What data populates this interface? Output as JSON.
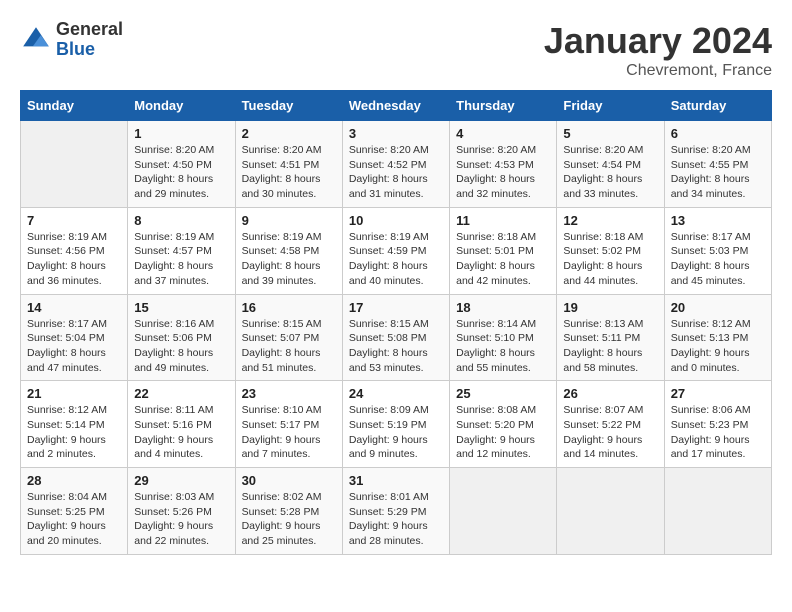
{
  "logo": {
    "general": "General",
    "blue": "Blue"
  },
  "header": {
    "month": "January 2024",
    "location": "Chevremont, France"
  },
  "weekdays": [
    "Sunday",
    "Monday",
    "Tuesday",
    "Wednesday",
    "Thursday",
    "Friday",
    "Saturday"
  ],
  "weeks": [
    [
      {
        "day": "",
        "info": ""
      },
      {
        "day": "1",
        "info": "Sunrise: 8:20 AM\nSunset: 4:50 PM\nDaylight: 8 hours\nand 29 minutes."
      },
      {
        "day": "2",
        "info": "Sunrise: 8:20 AM\nSunset: 4:51 PM\nDaylight: 8 hours\nand 30 minutes."
      },
      {
        "day": "3",
        "info": "Sunrise: 8:20 AM\nSunset: 4:52 PM\nDaylight: 8 hours\nand 31 minutes."
      },
      {
        "day": "4",
        "info": "Sunrise: 8:20 AM\nSunset: 4:53 PM\nDaylight: 8 hours\nand 32 minutes."
      },
      {
        "day": "5",
        "info": "Sunrise: 8:20 AM\nSunset: 4:54 PM\nDaylight: 8 hours\nand 33 minutes."
      },
      {
        "day": "6",
        "info": "Sunrise: 8:20 AM\nSunset: 4:55 PM\nDaylight: 8 hours\nand 34 minutes."
      }
    ],
    [
      {
        "day": "7",
        "info": "Sunrise: 8:19 AM\nSunset: 4:56 PM\nDaylight: 8 hours\nand 36 minutes."
      },
      {
        "day": "8",
        "info": "Sunrise: 8:19 AM\nSunset: 4:57 PM\nDaylight: 8 hours\nand 37 minutes."
      },
      {
        "day": "9",
        "info": "Sunrise: 8:19 AM\nSunset: 4:58 PM\nDaylight: 8 hours\nand 39 minutes."
      },
      {
        "day": "10",
        "info": "Sunrise: 8:19 AM\nSunset: 4:59 PM\nDaylight: 8 hours\nand 40 minutes."
      },
      {
        "day": "11",
        "info": "Sunrise: 8:18 AM\nSunset: 5:01 PM\nDaylight: 8 hours\nand 42 minutes."
      },
      {
        "day": "12",
        "info": "Sunrise: 8:18 AM\nSunset: 5:02 PM\nDaylight: 8 hours\nand 44 minutes."
      },
      {
        "day": "13",
        "info": "Sunrise: 8:17 AM\nSunset: 5:03 PM\nDaylight: 8 hours\nand 45 minutes."
      }
    ],
    [
      {
        "day": "14",
        "info": "Sunrise: 8:17 AM\nSunset: 5:04 PM\nDaylight: 8 hours\nand 47 minutes."
      },
      {
        "day": "15",
        "info": "Sunrise: 8:16 AM\nSunset: 5:06 PM\nDaylight: 8 hours\nand 49 minutes."
      },
      {
        "day": "16",
        "info": "Sunrise: 8:15 AM\nSunset: 5:07 PM\nDaylight: 8 hours\nand 51 minutes."
      },
      {
        "day": "17",
        "info": "Sunrise: 8:15 AM\nSunset: 5:08 PM\nDaylight: 8 hours\nand 53 minutes."
      },
      {
        "day": "18",
        "info": "Sunrise: 8:14 AM\nSunset: 5:10 PM\nDaylight: 8 hours\nand 55 minutes."
      },
      {
        "day": "19",
        "info": "Sunrise: 8:13 AM\nSunset: 5:11 PM\nDaylight: 8 hours\nand 58 minutes."
      },
      {
        "day": "20",
        "info": "Sunrise: 8:12 AM\nSunset: 5:13 PM\nDaylight: 9 hours\nand 0 minutes."
      }
    ],
    [
      {
        "day": "21",
        "info": "Sunrise: 8:12 AM\nSunset: 5:14 PM\nDaylight: 9 hours\nand 2 minutes."
      },
      {
        "day": "22",
        "info": "Sunrise: 8:11 AM\nSunset: 5:16 PM\nDaylight: 9 hours\nand 4 minutes."
      },
      {
        "day": "23",
        "info": "Sunrise: 8:10 AM\nSunset: 5:17 PM\nDaylight: 9 hours\nand 7 minutes."
      },
      {
        "day": "24",
        "info": "Sunrise: 8:09 AM\nSunset: 5:19 PM\nDaylight: 9 hours\nand 9 minutes."
      },
      {
        "day": "25",
        "info": "Sunrise: 8:08 AM\nSunset: 5:20 PM\nDaylight: 9 hours\nand 12 minutes."
      },
      {
        "day": "26",
        "info": "Sunrise: 8:07 AM\nSunset: 5:22 PM\nDaylight: 9 hours\nand 14 minutes."
      },
      {
        "day": "27",
        "info": "Sunrise: 8:06 AM\nSunset: 5:23 PM\nDaylight: 9 hours\nand 17 minutes."
      }
    ],
    [
      {
        "day": "28",
        "info": "Sunrise: 8:04 AM\nSunset: 5:25 PM\nDaylight: 9 hours\nand 20 minutes."
      },
      {
        "day": "29",
        "info": "Sunrise: 8:03 AM\nSunset: 5:26 PM\nDaylight: 9 hours\nand 22 minutes."
      },
      {
        "day": "30",
        "info": "Sunrise: 8:02 AM\nSunset: 5:28 PM\nDaylight: 9 hours\nand 25 minutes."
      },
      {
        "day": "31",
        "info": "Sunrise: 8:01 AM\nSunset: 5:29 PM\nDaylight: 9 hours\nand 28 minutes."
      },
      {
        "day": "",
        "info": ""
      },
      {
        "day": "",
        "info": ""
      },
      {
        "day": "",
        "info": ""
      }
    ]
  ]
}
